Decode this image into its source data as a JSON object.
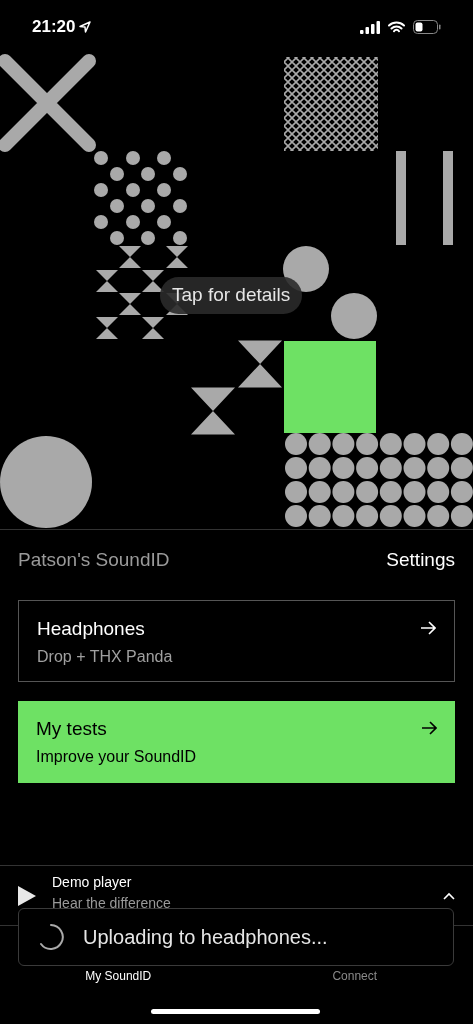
{
  "status_bar": {
    "time": "21:20"
  },
  "artwork": {
    "tooltip": "Tap for details"
  },
  "profile": {
    "title": "Patson's SoundID",
    "settings": "Settings"
  },
  "cards": [
    {
      "title": "Headphones",
      "subtitle": "Drop + THX Panda",
      "highlighted": false
    },
    {
      "title": "My tests",
      "subtitle": "Improve your SoundID",
      "highlighted": true
    }
  ],
  "player": {
    "title": "Demo player",
    "subtitle": "Hear the difference"
  },
  "tab_bar": [
    {
      "label": "My SoundID",
      "selected": true
    },
    {
      "label": "Connect",
      "selected": false
    }
  ],
  "toast": {
    "text": "Uploading to headphones..."
  }
}
